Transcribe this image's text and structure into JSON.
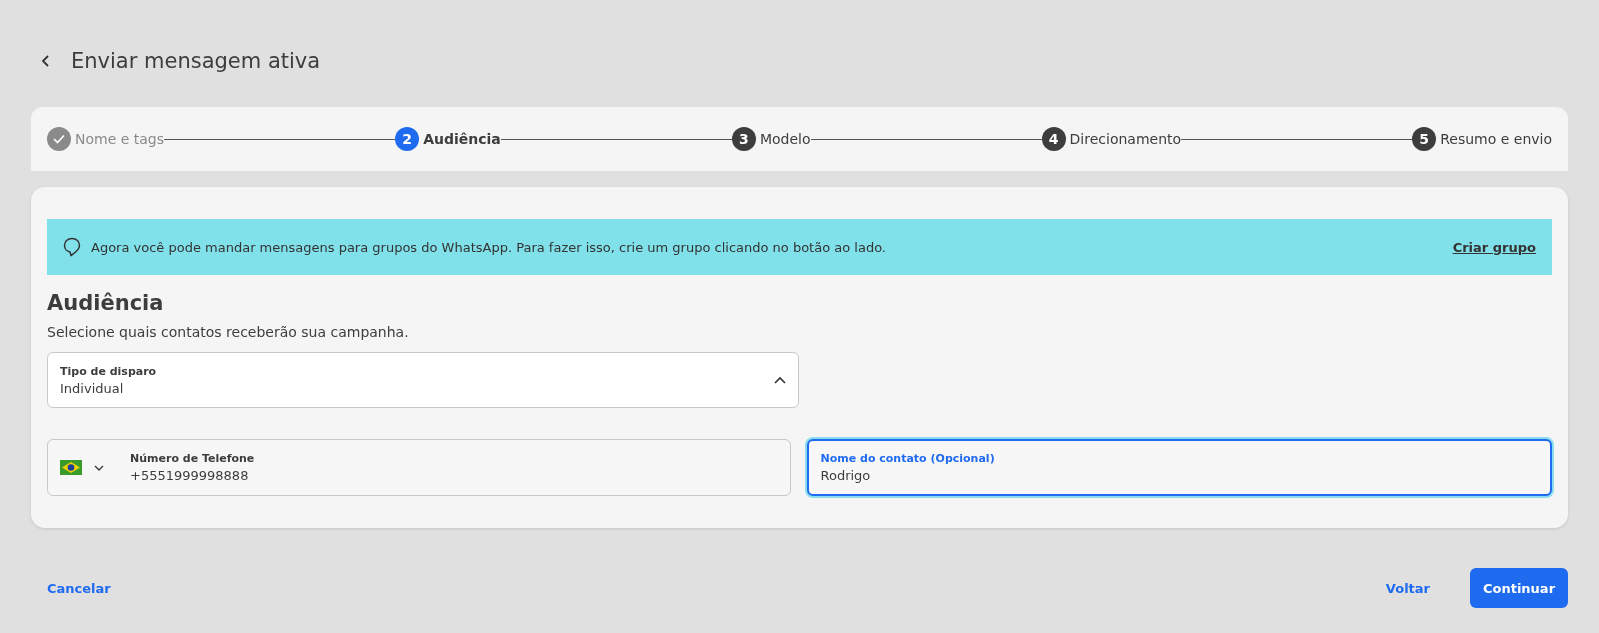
{
  "header": {
    "title": "Enviar mensagem ativa"
  },
  "steps": [
    {
      "label": "Nome e tags",
      "kind": "done"
    },
    {
      "number": "2",
      "label": "Audiência",
      "kind": "current"
    },
    {
      "number": "3",
      "label": "Modelo",
      "kind": "pending"
    },
    {
      "number": "4",
      "label": "Direcionamento",
      "kind": "pending"
    },
    {
      "number": "5",
      "label": "Resumo e envio",
      "kind": "pending"
    }
  ],
  "banner": {
    "text": "Agora você pode mandar mensagens para grupos do WhatsApp. Para fazer isso, crie um grupo clicando no botão ao lado.",
    "link": "Criar grupo"
  },
  "section": {
    "title": "Audiência",
    "subtitle": "Selecione quais contatos receberão sua campanha."
  },
  "dispatch_select": {
    "label": "Tipo de disparo",
    "value": "Individual"
  },
  "phone_field": {
    "label": "Número de Telefone",
    "value": "+5551999998888",
    "focused": false
  },
  "name_field": {
    "label": "Nome do contato (Opcional)",
    "value": "Rodrigo",
    "focused": true
  },
  "footer": {
    "cancel": "Cancelar",
    "back": "Voltar",
    "continue": "Continuar"
  }
}
